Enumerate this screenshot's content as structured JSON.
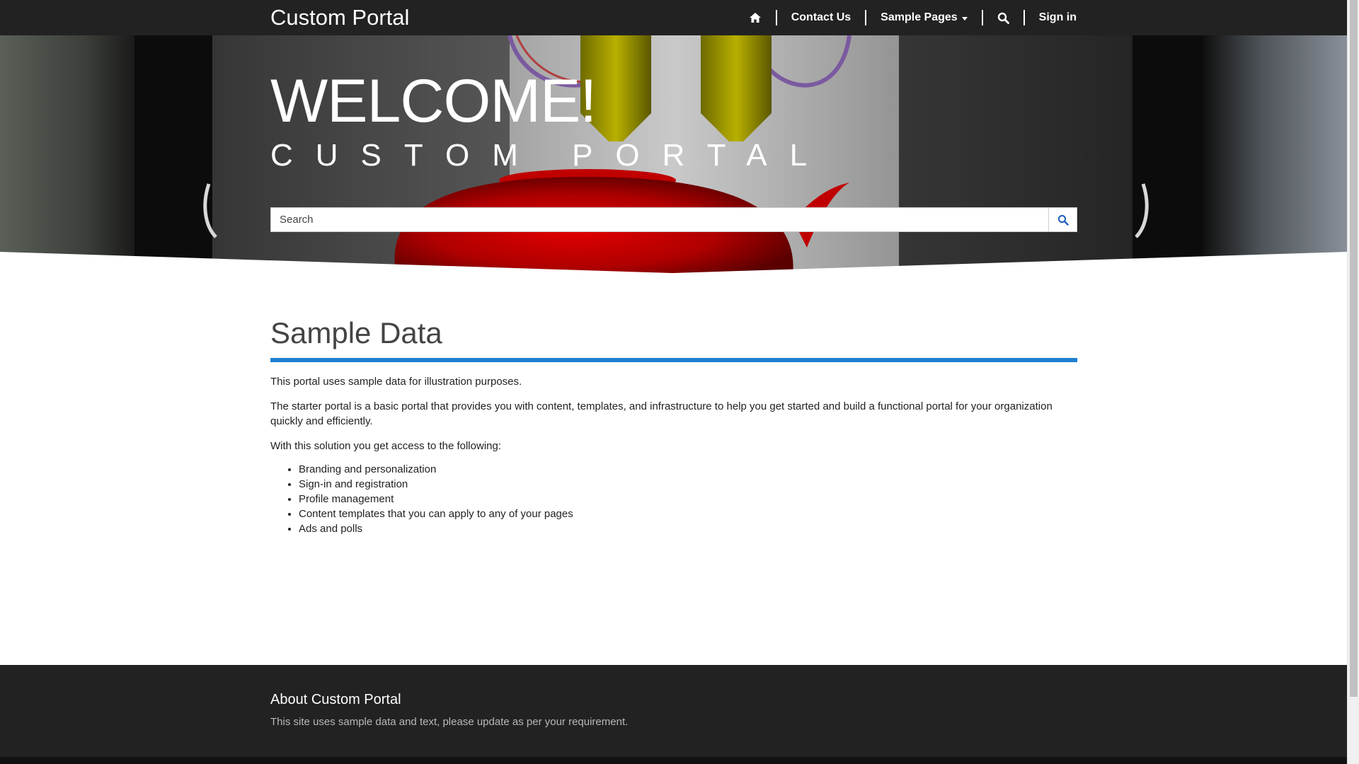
{
  "navbar": {
    "brand": "Custom Portal",
    "home_icon": "home-icon",
    "items": [
      {
        "label": "Contact Us"
      },
      {
        "label": "Sample Pages"
      }
    ],
    "search_icon": "search-icon",
    "signin_label": "Sign in"
  },
  "hero": {
    "title": "WELCOME!",
    "subtitle": "CUSTOM PORTAL",
    "search_placeholder": "Search",
    "search_button_icon": "search-icon"
  },
  "main": {
    "title": "Sample Data",
    "paragraphs": [
      "This portal uses sample data for illustration purposes.",
      "The starter portal is a basic portal that provides you with content, templates, and infrastructure to help you get started and build a functional portal for your organization quickly and efficiently.",
      "With this solution you get access to the following:"
    ],
    "list": [
      "Branding and personalization",
      "Sign-in and registration",
      "Profile management",
      "Content templates that you can apply to any of your pages",
      "Ads and polls"
    ]
  },
  "footer": {
    "title": "About Custom Portal",
    "text": "This site uses sample data and text, please update as per your requirement."
  },
  "colors": {
    "navbar_bg": "#222222",
    "accent": "#1e7fd0",
    "footer_bg": "#222222"
  }
}
